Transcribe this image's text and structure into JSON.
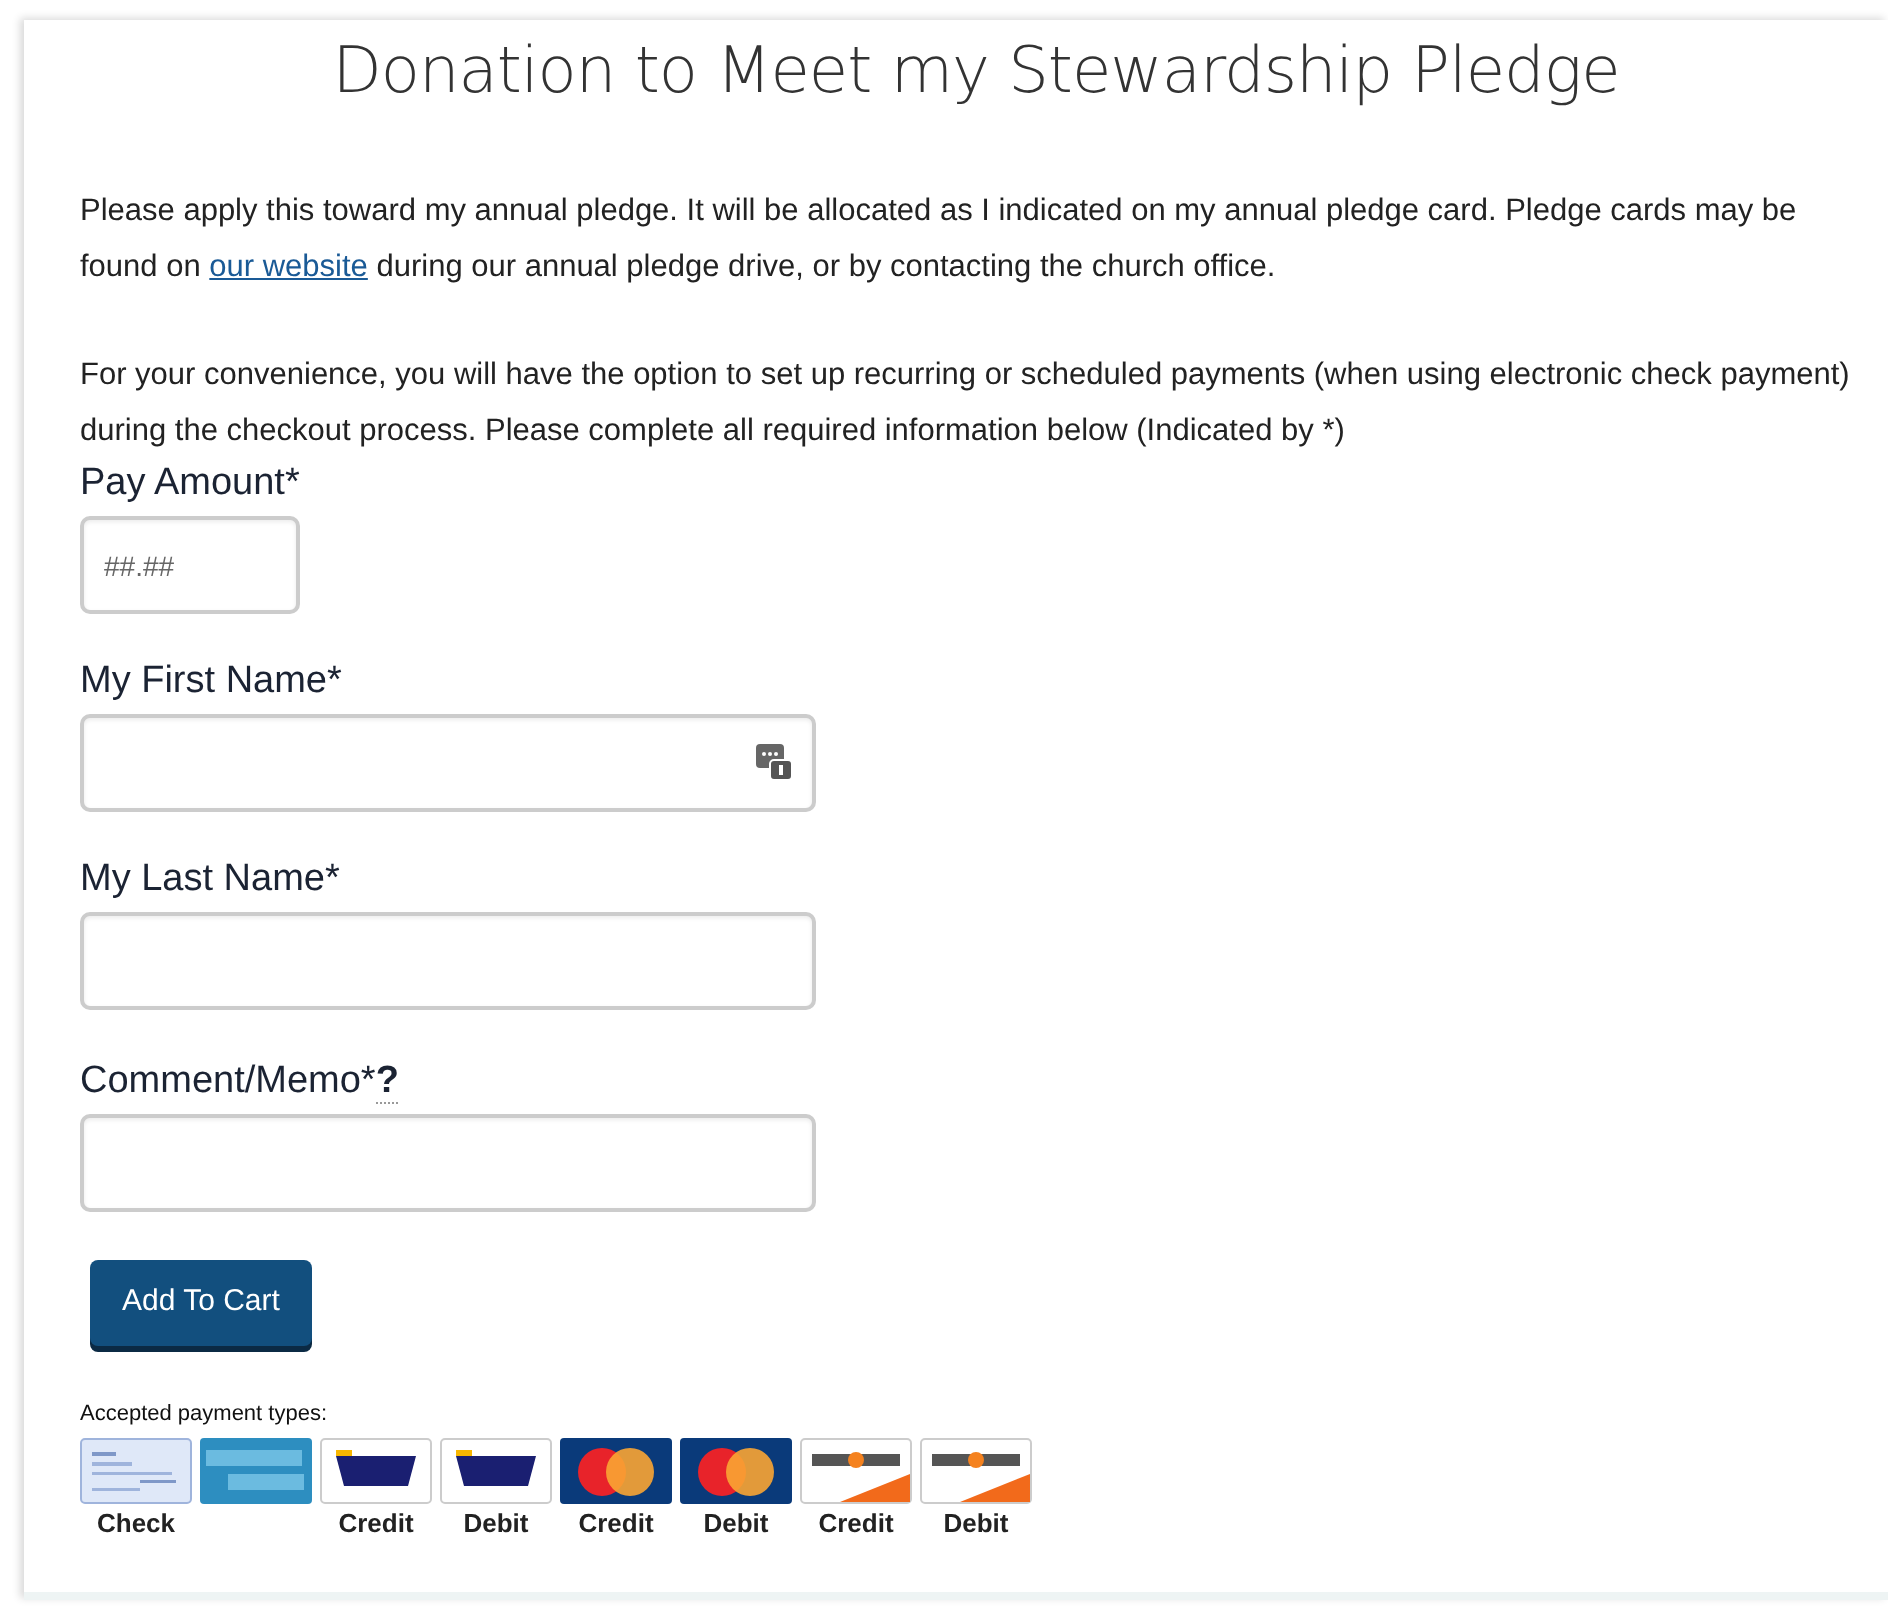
{
  "title": "Donation to Meet my Stewardship Pledge",
  "paragraphs": [
    {
      "before": "Please apply this toward my annual pledge. It will be allocated as I indicated on my annual pledge card. Pledge cards may be found on ",
      "link": "our website",
      "after": " during our annual pledge drive, or by contacting the church office."
    },
    {
      "before": "For your convenience, you will have the option to set up recurring or scheduled payments (when using electronic check payment) during the checkout process. Please complete all required information below (Indicated by *)"
    }
  ],
  "fields": [
    {
      "label": "Pay Amount*",
      "placeholder": "##.##",
      "kind": "amount"
    },
    {
      "label": "My First Name*",
      "kind": "text",
      "autofill_icon": true
    },
    {
      "label": "My Last Name*",
      "kind": "text"
    },
    {
      "label": "Comment/Memo*",
      "help": "?",
      "kind": "text"
    }
  ],
  "button": "Add To Cart",
  "payment_types_label": "Accepted payment types:",
  "payment_types": [
    {
      "kind": "check",
      "label": "Check"
    },
    {
      "kind": "amex"
    },
    {
      "kind": "visa",
      "label": "Credit"
    },
    {
      "kind": "visa",
      "label": "Debit"
    },
    {
      "kind": "mastercard",
      "label": "Credit"
    },
    {
      "kind": "mastercard",
      "label": "Debit"
    },
    {
      "kind": "discover",
      "label": "Credit"
    },
    {
      "kind": "discover",
      "label": "Debit"
    }
  ]
}
